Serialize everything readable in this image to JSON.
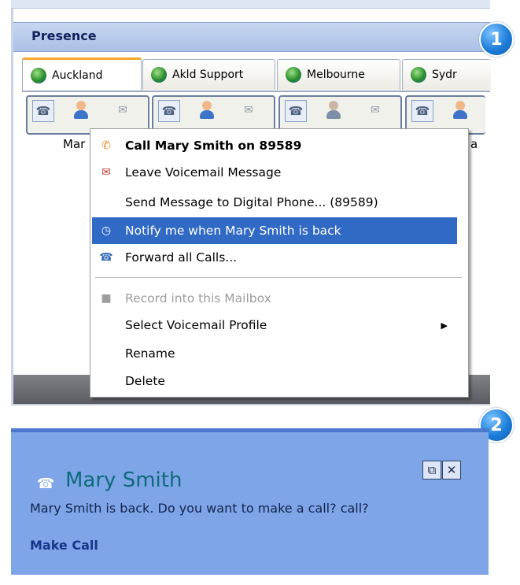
{
  "panel1": {
    "title": "Presence",
    "badge": "1",
    "tabs": [
      {
        "label": "Auckland"
      },
      {
        "label": "Akld Support"
      },
      {
        "label": "Melbourne"
      },
      {
        "label": "Sydr"
      }
    ],
    "contact_names": [
      "Mar",
      "a"
    ],
    "context_menu": {
      "items": [
        {
          "label": "Call Mary Smith on 89589",
          "icon": "call-icon"
        },
        {
          "label": "Leave Voicemail Message",
          "icon": "voicemail-icon"
        },
        {
          "label": "Send Message to Digital Phone... (89589)",
          "icon": ""
        },
        {
          "label": "Notify me when Mary Smith is back",
          "icon": "clock-icon"
        },
        {
          "label": "Forward all Calls...",
          "icon": "forward-icon"
        },
        {
          "label": "Record into this Mailbox",
          "icon": "mailbox-icon"
        },
        {
          "label": "Select Voicemail Profile",
          "icon": ""
        },
        {
          "label": "Rename",
          "icon": ""
        },
        {
          "label": "Delete",
          "icon": ""
        }
      ]
    }
  },
  "panel2": {
    "badge": "2",
    "notification": {
      "title": "Mary Smith",
      "message": "Mary Smith is back. Do you want to make a call? call?",
      "link": "Make Call"
    }
  },
  "colors": {
    "menu_highlight": "#316ac5",
    "toast_bg": "#7ea5e8",
    "title_teal": "#0e6b7a"
  }
}
